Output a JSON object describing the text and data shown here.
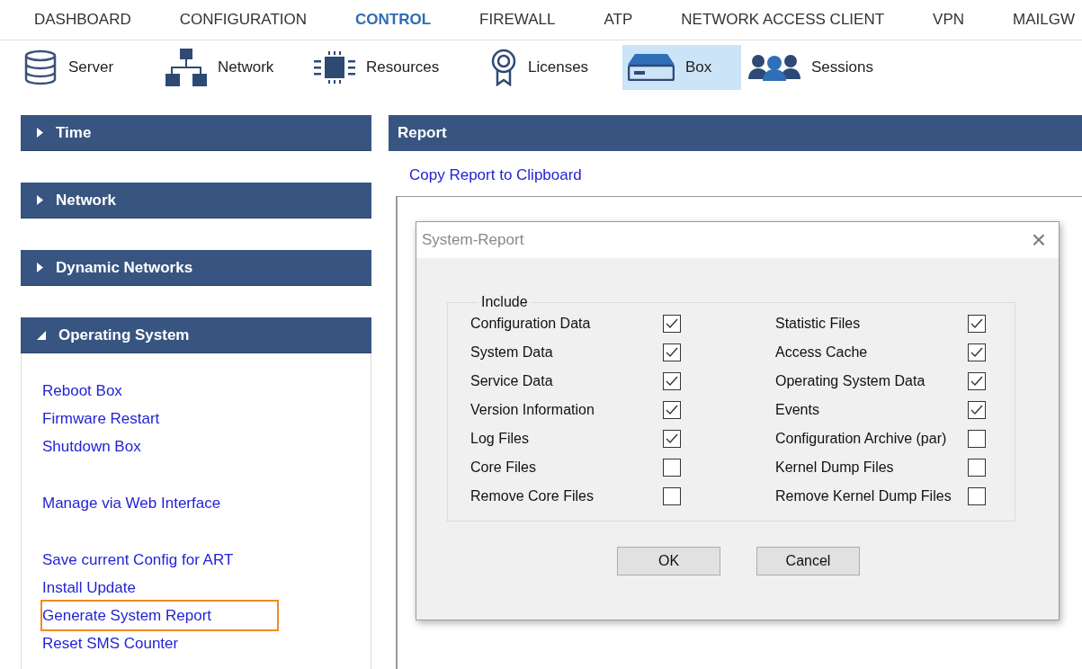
{
  "main_nav": [
    {
      "label": "DASHBOARD",
      "selected": false
    },
    {
      "label": "CONFIGURATION",
      "selected": false
    },
    {
      "label": "CONTROL",
      "selected": true
    },
    {
      "label": "FIREWALL",
      "selected": false
    },
    {
      "label": "ATP",
      "selected": false
    },
    {
      "label": "NETWORK ACCESS CLIENT",
      "selected": false
    },
    {
      "label": "VPN",
      "selected": false
    },
    {
      "label": "MAILGW",
      "selected": false
    }
  ],
  "toolbar": [
    {
      "kind": "server",
      "label": "Server",
      "selected": false
    },
    {
      "kind": "network",
      "label": "Network",
      "selected": false
    },
    {
      "kind": "resources",
      "label": "Resources",
      "selected": false
    },
    {
      "kind": "licenses",
      "label": "Licenses",
      "selected": false
    },
    {
      "kind": "box",
      "label": "Box",
      "selected": true
    },
    {
      "kind": "sessions",
      "label": "Sessions",
      "selected": false
    }
  ],
  "sidebar": {
    "sections": [
      {
        "title": "Time",
        "expanded": false
      },
      {
        "title": "Network",
        "expanded": false
      },
      {
        "title": "Dynamic Networks",
        "expanded": false
      },
      {
        "title": "Operating System",
        "expanded": true,
        "groups": [
          [
            {
              "label": "Reboot Box",
              "highlighted": false
            },
            {
              "label": "Firmware Restart",
              "highlighted": false
            },
            {
              "label": "Shutdown Box",
              "highlighted": false
            }
          ],
          [
            {
              "label": "Manage via Web Interface",
              "highlighted": false
            }
          ],
          [
            {
              "label": "Save current Config for ART",
              "highlighted": false
            },
            {
              "label": "Install Update",
              "highlighted": false
            },
            {
              "label": "Generate System Report",
              "highlighted": true
            },
            {
              "label": "Reset SMS Counter",
              "highlighted": false
            }
          ]
        ]
      }
    ]
  },
  "report": {
    "title": "Report",
    "copy_link": "Copy Report to Clipboard"
  },
  "dialog": {
    "title": "System-Report",
    "close": "×",
    "group_title": "Include",
    "options": [
      {
        "label": "Configuration Data",
        "checked": true
      },
      {
        "label": "Statistic Files",
        "checked": true
      },
      {
        "label": "System Data",
        "checked": true
      },
      {
        "label": "Access Cache",
        "checked": true
      },
      {
        "label": "Service Data",
        "checked": true
      },
      {
        "label": "Operating System Data",
        "checked": true
      },
      {
        "label": "Version Information",
        "checked": true
      },
      {
        "label": "Events",
        "checked": true
      },
      {
        "label": "Log Files",
        "checked": true
      },
      {
        "label": "Configuration Archive (par)",
        "checked": false
      },
      {
        "label": "Core Files",
        "checked": false
      },
      {
        "label": "Kernel Dump Files",
        "checked": false
      },
      {
        "label": "Remove Core Files",
        "checked": false
      },
      {
        "label": "Remove Kernel Dump Files",
        "checked": false
      }
    ],
    "buttons": [
      "OK",
      "Cancel"
    ]
  }
}
